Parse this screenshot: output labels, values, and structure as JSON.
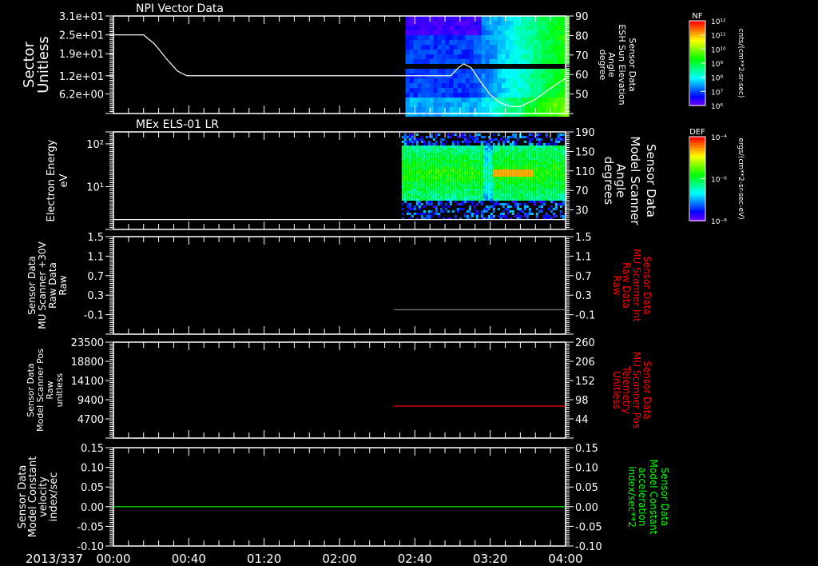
{
  "time_axis": {
    "date_label": "2013/337",
    "ticks": [
      "00:00",
      "00:40",
      "01:20",
      "02:00",
      "02:40",
      "03:20",
      "04:00"
    ],
    "range_minutes": [
      0,
      240
    ]
  },
  "chart_data": [
    {
      "type": "line+spectrogram",
      "title": "NPI Vector Data",
      "left_axis": {
        "label_lines": [
          "Sector",
          "Unitless"
        ],
        "ticks": [
          "3.1e+01",
          "2.5e+01",
          "1.9e+01",
          "1.2e+01",
          "6.2e+00"
        ],
        "tick_values": [
          31,
          25,
          19,
          12,
          6.2
        ],
        "ylim": [
          0,
          31
        ],
        "scale": "linear"
      },
      "right_axis": {
        "label_lines": [
          "Sensor Data",
          "ESH Sun Elevation",
          "Angle",
          "degree"
        ],
        "ticks": [
          "90",
          "80",
          "70",
          "60",
          "50"
        ],
        "tick_values": [
          90,
          80,
          70,
          60,
          50
        ],
        "ylim": [
          40,
          90
        ],
        "color": "#ffffff"
      },
      "series": [
        {
          "axis": "left",
          "color": "#ffffff",
          "t_minutes": [
            0,
            16,
            22,
            28,
            34,
            39,
            179,
            183,
            186,
            190,
            195,
            200,
            205,
            210,
            216,
            224,
            232,
            240
          ],
          "values": [
            25,
            25,
            22,
            17.5,
            13.5,
            12,
            12,
            14.5,
            15.8,
            14.5,
            10,
            6,
            3.5,
            2.3,
            2.2,
            4.5,
            8,
            11.2
          ]
        }
      ],
      "spectrogram": {
        "start_minutes": 155,
        "end_minutes": 240,
        "colorbar": 0
      }
    },
    {
      "type": "spectrogram",
      "title": "MEx ELS-01 LR",
      "left_axis": {
        "label_lines": [
          "Electron Energy",
          "eV"
        ],
        "ticks": [
          "10²",
          "10¹"
        ],
        "tick_values": [
          100,
          10
        ],
        "ylim": [
          1,
          190
        ],
        "scale": "log"
      },
      "right_axis": {
        "label_lines": [
          "Sensor Data",
          "Model Scanner",
          "Angle",
          "degrees"
        ],
        "ticks": [
          "190",
          "150",
          "110",
          "70",
          "30"
        ],
        "tick_values": [
          190,
          150,
          110,
          70,
          30
        ],
        "ylim": [
          -10,
          190
        ],
        "color": "#ffffff"
      },
      "series": [
        {
          "axis": "left",
          "color": "#ffffff",
          "t_minutes": [
            0,
            240
          ],
          "values": [
            1.7,
            1.7
          ]
        }
      ],
      "spectrogram": {
        "start_minutes": 153,
        "end_minutes": 240,
        "colorbar": 1
      }
    },
    {
      "type": "line",
      "title": "",
      "left_axis": {
        "label_lines": [
          "Sensor Data",
          "MU Scanner +30V",
          "Raw Data",
          "Raw"
        ],
        "ticks": [
          "1.5",
          "1.1",
          "0.7",
          "0.3",
          "-0.1"
        ],
        "tick_values": [
          1.5,
          1.1,
          0.7,
          0.3,
          -0.1
        ],
        "ylim": [
          -0.5,
          1.5
        ],
        "scale": "linear"
      },
      "right_axis": {
        "label_lines": [
          "Sensor Data",
          "MU Scanner Int",
          "Raw Data",
          "Raw"
        ],
        "ticks": [
          "1.5",
          "1.1",
          "0.7",
          "0.3",
          "-0.1"
        ],
        "tick_values": [
          1.5,
          1.1,
          0.7,
          0.3,
          -0.1
        ],
        "ylim": [
          -0.5,
          1.5
        ],
        "color": "#ff0000"
      },
      "series": [
        {
          "axis": "right",
          "color": "#808080",
          "t_minutes": [
            149,
            240
          ],
          "values": [
            0,
            0
          ]
        }
      ]
    },
    {
      "type": "line",
      "title": "",
      "left_axis": {
        "label_lines": [
          "Sensor Data",
          "Model Scanner Pos",
          "Raw",
          "unitless"
        ],
        "ticks": [
          "23500",
          "18800",
          "14100",
          "9400",
          "4700"
        ],
        "tick_values": [
          23500,
          18800,
          14100,
          9400,
          4700
        ],
        "ylim": [
          0,
          23500
        ],
        "scale": "linear"
      },
      "right_axis": {
        "label_lines": [
          "Sensor Data",
          "MU Scanner Pos",
          "Telemetry",
          "Unitless"
        ],
        "ticks": [
          "260",
          "206",
          "152",
          "98",
          "44"
        ],
        "tick_values": [
          260,
          206,
          152,
          98,
          44
        ],
        "ylim": [
          -10,
          260
        ],
        "color": "#ff0000"
      },
      "series": [
        {
          "axis": "right",
          "color": "#ff0000",
          "t_minutes": [
            149,
            240
          ],
          "values": [
            80,
            80
          ]
        }
      ]
    },
    {
      "type": "line",
      "title": "",
      "left_axis": {
        "label_lines": [
          "Sensor Data",
          "Model Constant",
          "velocity",
          "index/sec"
        ],
        "ticks": [
          "0.15",
          "0.10",
          "0.05",
          "0.00",
          "-0.05",
          "-0.10"
        ],
        "tick_values": [
          0.15,
          0.1,
          0.05,
          0,
          -0.05,
          -0.1
        ],
        "ylim": [
          -0.1,
          0.15
        ],
        "scale": "linear"
      },
      "right_axis": {
        "label_lines": [
          "Sensor Data",
          "Model Constant",
          "acceleration",
          "index/sec**2"
        ],
        "ticks": [
          "0.15",
          "0.10",
          "0.05",
          "0.00",
          "-0.05",
          "-0.10"
        ],
        "tick_values": [
          0.15,
          0.1,
          0.05,
          0,
          -0.05,
          -0.1
        ],
        "ylim": [
          -0.1,
          0.15
        ],
        "color": "#00ff00"
      },
      "series": [
        {
          "axis": "left",
          "color": "#00ff00",
          "t_minutes": [
            0,
            240
          ],
          "values": [
            0,
            0
          ]
        }
      ]
    }
  ],
  "colorbars": [
    {
      "title": "NF",
      "units": "cnts/(cm**2-sr-sec)",
      "ticks": [
        "10¹²",
        "10¹¹",
        "10¹⁰",
        "10⁹",
        "10⁸",
        "10⁷",
        "10⁶"
      ],
      "colormap": "rainbow"
    },
    {
      "title": "DEF",
      "units": "ergs/(cm**2-sr-sec-eV)",
      "ticks": [
        "10⁻⁴",
        "10⁻⁶",
        "10⁻⁸"
      ],
      "colormap": "rainbow"
    }
  ]
}
